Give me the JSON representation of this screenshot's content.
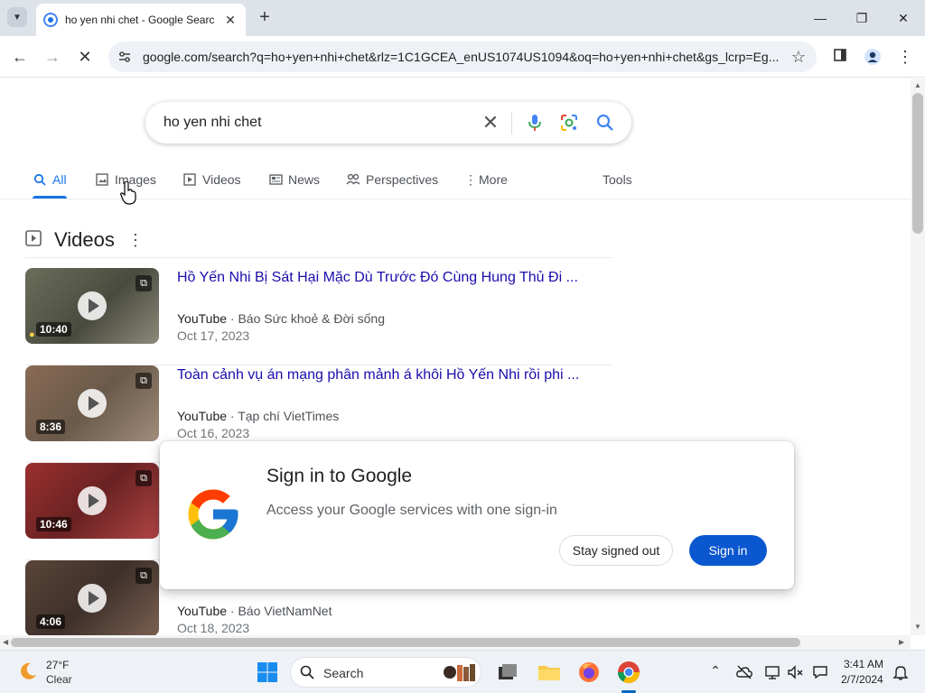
{
  "browser": {
    "tab_title": "ho yen nhi chet - Google Searc",
    "url": "google.com/search?q=ho+yen+nhi+chet&rlz=1C1GCEA_enUS1074US1094&oq=ho+yen+nhi+chet&gs_lcrp=Eg..."
  },
  "search": {
    "query": "ho yen nhi chet"
  },
  "filters": [
    {
      "label": "All",
      "icon": "search-icon",
      "active": true
    },
    {
      "label": "Images",
      "icon": "image-icon"
    },
    {
      "label": "Videos",
      "icon": "video-icon"
    },
    {
      "label": "News",
      "icon": "news-icon"
    },
    {
      "label": "Perspectives",
      "icon": "people-icon"
    },
    {
      "label": "More",
      "icon": "kebab-icon"
    }
  ],
  "tools_label": "Tools",
  "videos_section": {
    "title": "Videos",
    "items": [
      {
        "title": "Hồ Yến Nhi Bị Sát Hại Mặc Dù Trước Đó Cùng Hung Thủ Đi ...",
        "source": "YouTube",
        "channel": "Báo Sức khoẻ & Đời sống",
        "date": "Oct 17, 2023",
        "duration": "10:40",
        "thumb_color": "#5a5f4a"
      },
      {
        "title": "Toàn cảnh vụ án mạng phân mảnh á khôi Hồ Yến Nhi rồi phi ...",
        "source": "YouTube",
        "channel": "Tạp chí VietTimes",
        "date": "Oct 16, 2023",
        "duration": "8:36",
        "thumb_color": "#7a5a48"
      },
      {
        "title": "",
        "source": "",
        "channel": "",
        "date": "",
        "duration": "10:46",
        "thumb_color": "#8a2a2a"
      },
      {
        "title": "",
        "source": "YouTube",
        "channel": "Báo VietNamNet",
        "date": "Oct 18, 2023",
        "duration": "4:06",
        "thumb_color": "#4a3a30"
      }
    ]
  },
  "signin_popup": {
    "title": "Sign in to Google",
    "subtitle": "Access your Google services with one sign-in",
    "stay_signed_out": "Stay signed out",
    "sign_in": "Sign in"
  },
  "taskbar": {
    "temperature": "27°F",
    "weather": "Clear",
    "search_label": "Search",
    "time": "3:41 AM",
    "date": "2/7/2024"
  },
  "colors": {
    "link_blue": "#1a0dab",
    "accent_blue": "#1a73e8",
    "signin_blue": "#0b57d0"
  }
}
